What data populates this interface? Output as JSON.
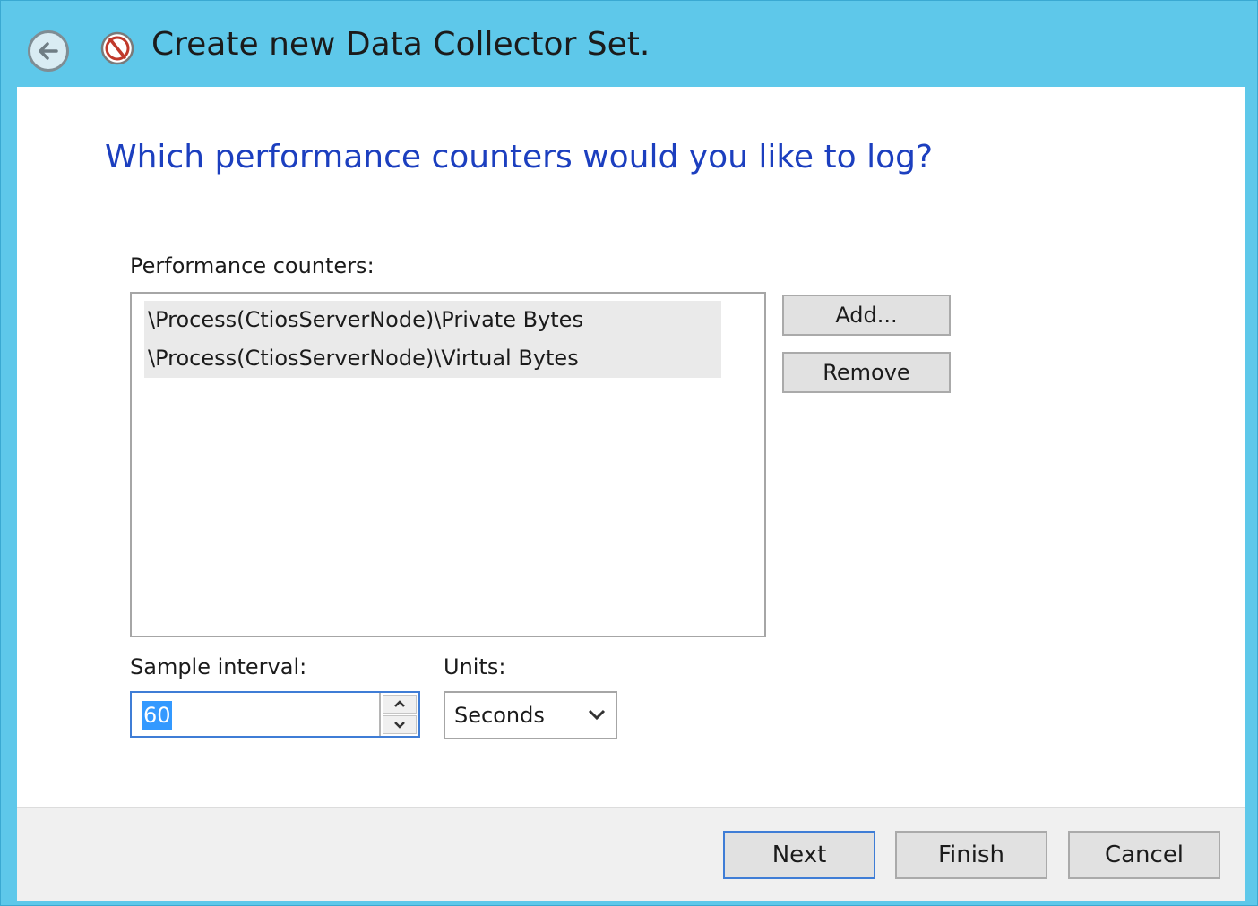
{
  "window": {
    "title": "Create new Data Collector Set."
  },
  "icons": {
    "back": "back-arrow-icon",
    "app": "performance-monitor-icon",
    "spin_up": "chevron-up-icon",
    "spin_down": "chevron-down-icon",
    "dropdown": "chevron-down-icon"
  },
  "page": {
    "heading": "Which performance counters would you like to log?",
    "counters_label": "Performance counters:",
    "counters": [
      "\\Process(CtiosServerNode)\\Private Bytes",
      "\\Process(CtiosServerNode)\\Virtual Bytes"
    ],
    "add_label": "Add...",
    "remove_label": "Remove",
    "sample_interval_label": "Sample interval:",
    "sample_interval_value": "60",
    "units_label": "Units:",
    "units_value": "Seconds"
  },
  "footer": {
    "next_label": "Next",
    "finish_label": "Finish",
    "cancel_label": "Cancel"
  },
  "colors": {
    "titlebar": "#5ec8ea",
    "heading": "#1c3fbf",
    "selection": "#3399ff",
    "focus_border": "#3f7dd6"
  }
}
